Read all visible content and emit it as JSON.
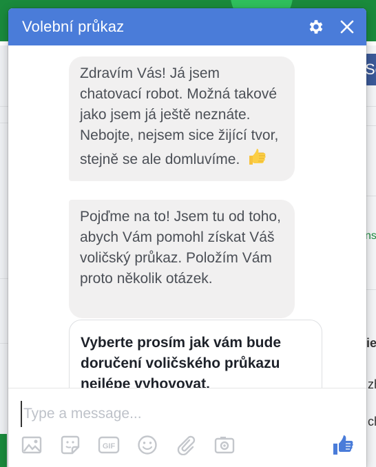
{
  "chat": {
    "title": "Volební průkaz",
    "messages": [
      "Zdravím Vás! Já jsem chatovací robot. Možná takové jako jsem já ještě neznáte. Nebojte, nejsem sice žijící tvor, stejně se ale domluvíme.",
      "Pojďme na to! Jsem tu od toho, abych Vám pomohl získat Váš voličský průkaz. Položím Vám proto několik otázek."
    ],
    "card_text": "Vyberte prosím jak vám bude doručení voličského průkazu nejlépe vyhovovat.",
    "input_placeholder": "Type a message...",
    "icons": {
      "settings": "gear-icon",
      "close": "close-icon",
      "emoji": "thumbs-up-emoji",
      "tools": [
        "image-icon",
        "sticker-icon",
        "gif-icon",
        "emoji-icon",
        "attachment-icon",
        "camera-icon"
      ],
      "send": "like-icon"
    },
    "gif_label": "GIF"
  },
  "background": {
    "fragment_1": "Sc",
    "fragment_2": "ns",
    "fragment_3": "ie",
    "fragment_4": "zh",
    "fragment_5": "ch"
  },
  "colors": {
    "header": "#4a7cd9",
    "bubble": "#f1f0f0",
    "like": "#4a7cd9",
    "icon_gray": "#c4c7cc"
  }
}
